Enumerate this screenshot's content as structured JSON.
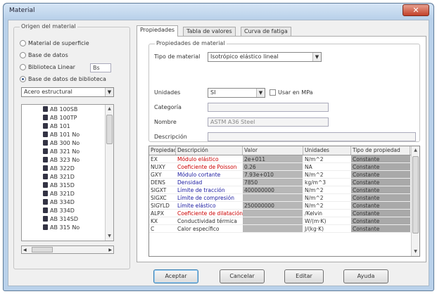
{
  "window": {
    "title": "Material",
    "close_glyph": "✕"
  },
  "source": {
    "group_label": "Origen del material",
    "options": [
      {
        "label": "Material de superficie",
        "selected": false
      },
      {
        "label": "Base de datos",
        "selected": false
      },
      {
        "label": "Biblioteca Linear",
        "selected": false
      },
      {
        "label": "Base de datos de biblioteca",
        "selected": true
      }
    ],
    "linear_value": "Bs",
    "library_combo": "Acero estructural",
    "library_items": [
      "AB 100SB",
      "AB 100TP",
      "AB 101",
      "AB 101 No",
      "AB 300 No",
      "AB 321 No",
      "AB 323 No",
      "AB 322D",
      "AB 321D",
      "AB 315D",
      "AB 321D",
      "AB 334D",
      "AB 334D",
      "AB 314SD",
      "AB 315 No"
    ]
  },
  "tabs": [
    "Propiedades",
    "Tabla de valores",
    "Curva de fatiga"
  ],
  "properties": {
    "group_label": "Propiedades de material",
    "tipo_label": "Tipo de material",
    "tipo_value": "Isotrópico elástico lineal",
    "unidades_label": "Unidades",
    "unidades_value": "SI",
    "checkbox_label": "Usar en MPa",
    "categoria_label": "Categoría",
    "categoria_value": "",
    "nombre_label": "Nombre",
    "nombre_value": "ASTM A36 Steel",
    "descripcion_label": "Descripción",
    "descripcion_value": ""
  },
  "table": {
    "columns": [
      "Propiedad",
      "Descripción",
      "Valor",
      "Unidades",
      "Tipo de propiedad"
    ],
    "rows": [
      {
        "prop": "EX",
        "desc": "Módulo elástico",
        "desc_color": "#cc0000",
        "val": "2e+011",
        "unit": "N/m^2",
        "tipo": "Constante"
      },
      {
        "prop": "NUXY",
        "desc": "Coeficiente de Poisson",
        "desc_color": "#cc0000",
        "val": "0.26",
        "unit": "NA",
        "tipo": "Constante"
      },
      {
        "prop": "GXY",
        "desc": "Módulo cortante",
        "desc_color": "#1a1aa0",
        "val": "7.93e+010",
        "unit": "N/m^2",
        "tipo": "Constante"
      },
      {
        "prop": "DENS",
        "desc": "Densidad",
        "desc_color": "#1a1aa0",
        "val": "7850",
        "unit": "kg/m^3",
        "tipo": "Constante"
      },
      {
        "prop": "SIGXT",
        "desc": "Límite de tracción",
        "desc_color": "#1a1aa0",
        "val": "400000000",
        "unit": "N/m^2",
        "tipo": "Constante"
      },
      {
        "prop": "SIGXC",
        "desc": "Límite de compresión",
        "desc_color": "#1a1aa0",
        "val": "",
        "unit": "N/m^2",
        "tipo": "Constante"
      },
      {
        "prop": "SIGYLD",
        "desc": "Límite elástico",
        "desc_color": "#1a1aa0",
        "val": "250000000",
        "unit": "N/m^2",
        "tipo": "Constante"
      },
      {
        "prop": "ALPX",
        "desc": "Coeficiente de dilatación",
        "desc_color": "#cc0000",
        "val": "",
        "unit": "/Kelvin",
        "tipo": "Constante"
      },
      {
        "prop": "KX",
        "desc": "Conductividad térmica",
        "desc_color": "#333333",
        "val": "",
        "unit": "W/(m·K)",
        "tipo": "Constante"
      },
      {
        "prop": "C",
        "desc": "Calor específico",
        "desc_color": "#333333",
        "val": "",
        "unit": "J/(kg·K)",
        "tipo": "Constante"
      }
    ]
  },
  "buttons": {
    "aceptar": "Aceptar",
    "cancelar": "Cancelar",
    "editar": "Editar",
    "ayuda": "Ayuda"
  }
}
